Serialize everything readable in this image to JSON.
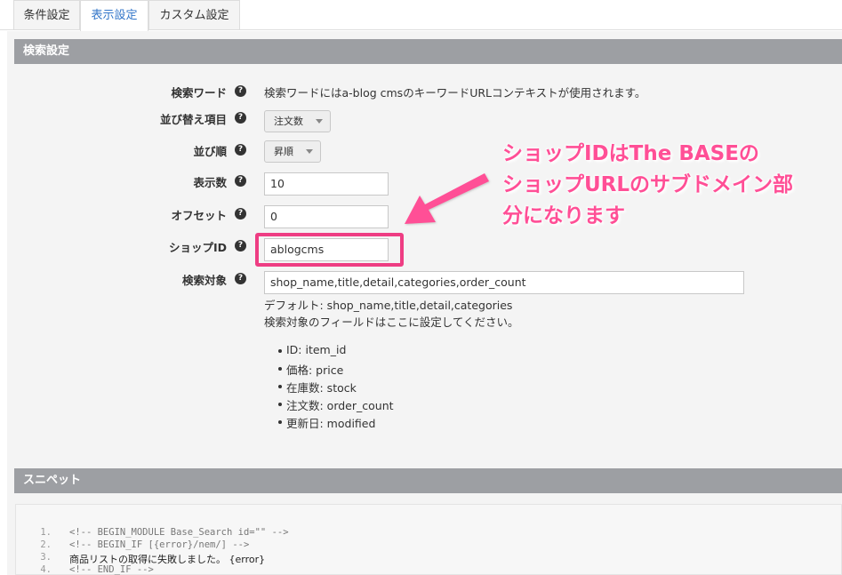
{
  "tabs": [
    {
      "label": "条件設定"
    },
    {
      "label": "表示設定"
    },
    {
      "label": "カスタム設定"
    }
  ],
  "section_search": {
    "title": "検索設定",
    "rows": {
      "keyword": {
        "label": "検索ワード",
        "help_icon": "?",
        "value": "検索ワードにはa-blog cmsのキーワードURLコンテキストが使用されます。"
      },
      "sort_item": {
        "label": "並び替え項目",
        "help_icon": "?",
        "value": "注文数"
      },
      "sort_order": {
        "label": "並び順",
        "help_icon": "?",
        "value": "昇順"
      },
      "count": {
        "label": "表示数",
        "help_icon": "?",
        "value": "10"
      },
      "offset": {
        "label": "オフセット",
        "help_icon": "?",
        "value": "0"
      },
      "shop_id": {
        "label": "ショップID",
        "help_icon": "?",
        "value": "ablogcms"
      },
      "target": {
        "label": "検索対象",
        "help_icon": "?",
        "value": "shop_name,title,detail,categories,order_count",
        "default_text": "デフォルト: shop_name,title,detail,categories",
        "help_text": "検索対象のフィールドはここに設定してください。",
        "fields": [
          "ID: item_id",
          "価格: price",
          "在庫数: stock",
          "注文数: order_count",
          "更新日: modified"
        ]
      }
    }
  },
  "annotation": {
    "lines": [
      "ショップIDはThe BASEの",
      "ショップURLのサブドメイン部",
      "分になります"
    ],
    "color": "#ff4f96"
  },
  "section_snippet": {
    "title": "スニペット",
    "code_lines": [
      {
        "num": "1.",
        "text": "<!-- BEGIN_MODULE Base_Search id=\"\" -->"
      },
      {
        "num": "2.",
        "text": "<!-- BEGIN_IF [{error}/nem/] -->"
      },
      {
        "num": "3.",
        "text": "商品リストの取得に失敗しました。 {error}"
      },
      {
        "num": "4.",
        "text": "<!-- END_IF -->"
      }
    ]
  },
  "colors": {
    "active_tab_text": "#3376c9",
    "section_header_bg": "#9d9fa3",
    "highlight": "#ee3d83"
  }
}
